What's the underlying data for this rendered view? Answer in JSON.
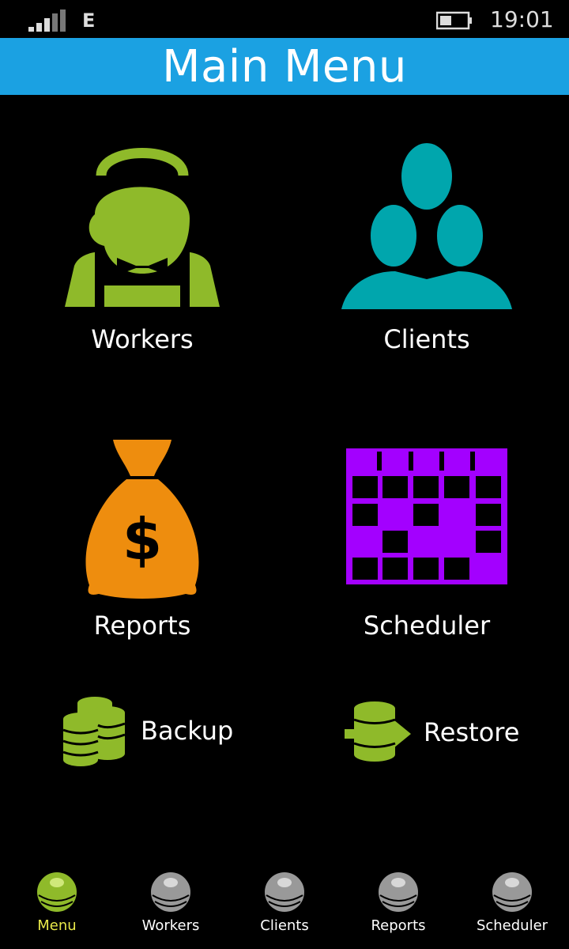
{
  "status_bar": {
    "network": "E",
    "time": "19:01"
  },
  "header": {
    "title": "Main Menu"
  },
  "tiles": {
    "workers": {
      "label": "Workers",
      "color": "#8fba2a"
    },
    "clients": {
      "label": "Clients",
      "color": "#00a6ad"
    },
    "reports": {
      "label": "Reports",
      "color": "#ee8d0e"
    },
    "scheduler": {
      "label": "Scheduler",
      "color": "#a300ff"
    }
  },
  "actions": {
    "backup": {
      "label": "Backup",
      "icon": "database-stack-icon"
    },
    "restore": {
      "label": "Restore",
      "icon": "database-arrow-icon"
    }
  },
  "app_bar": {
    "items": [
      {
        "label": "Menu",
        "active": true
      },
      {
        "label": "Workers",
        "active": false
      },
      {
        "label": "Clients",
        "active": false
      },
      {
        "label": "Reports",
        "active": false
      },
      {
        "label": "Scheduler",
        "active": false
      }
    ],
    "active_color": "#e9e94a",
    "inactive_color": "#ffffff"
  }
}
